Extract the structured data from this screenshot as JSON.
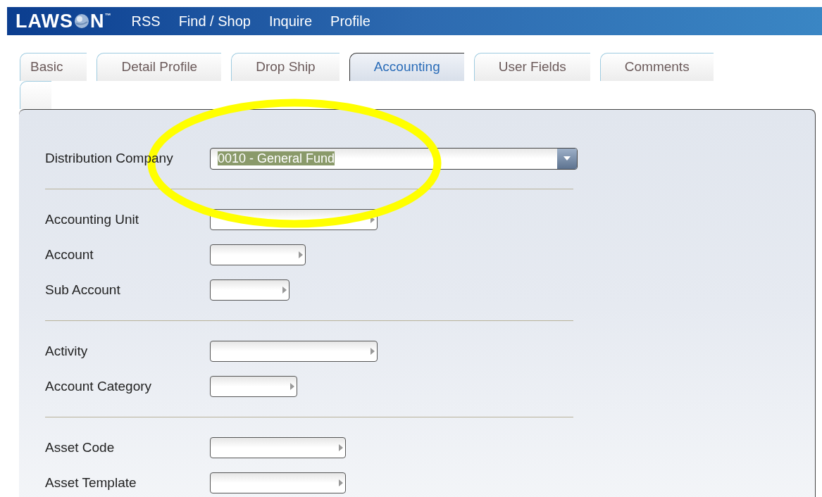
{
  "header": {
    "logo": {
      "before": "LAWS",
      "after": "N",
      "mark": "™"
    },
    "menu": [
      "RSS",
      "Find / Shop",
      "Inquire",
      "Profile"
    ]
  },
  "tabs": [
    {
      "label": "Basic",
      "selected": false
    },
    {
      "label": "Detail Profile",
      "selected": false
    },
    {
      "label": "Drop Ship",
      "selected": false
    },
    {
      "label": "Accounting",
      "selected": true
    },
    {
      "label": "User Fields",
      "selected": false
    },
    {
      "label": "Comments",
      "selected": false
    }
  ],
  "form": {
    "company": {
      "label": "Distribution Company",
      "value": "0010 - General Fund",
      "value_highlighted": true
    },
    "sections": [
      [
        {
          "label": "Accounting Unit"
        },
        {
          "label": "Account"
        },
        {
          "label": "Sub Account"
        }
      ],
      [
        {
          "label": "Activity"
        },
        {
          "label": "Account Category"
        }
      ],
      [
        {
          "label": "Asset Code"
        },
        {
          "label": "Asset Template"
        }
      ]
    ]
  }
}
